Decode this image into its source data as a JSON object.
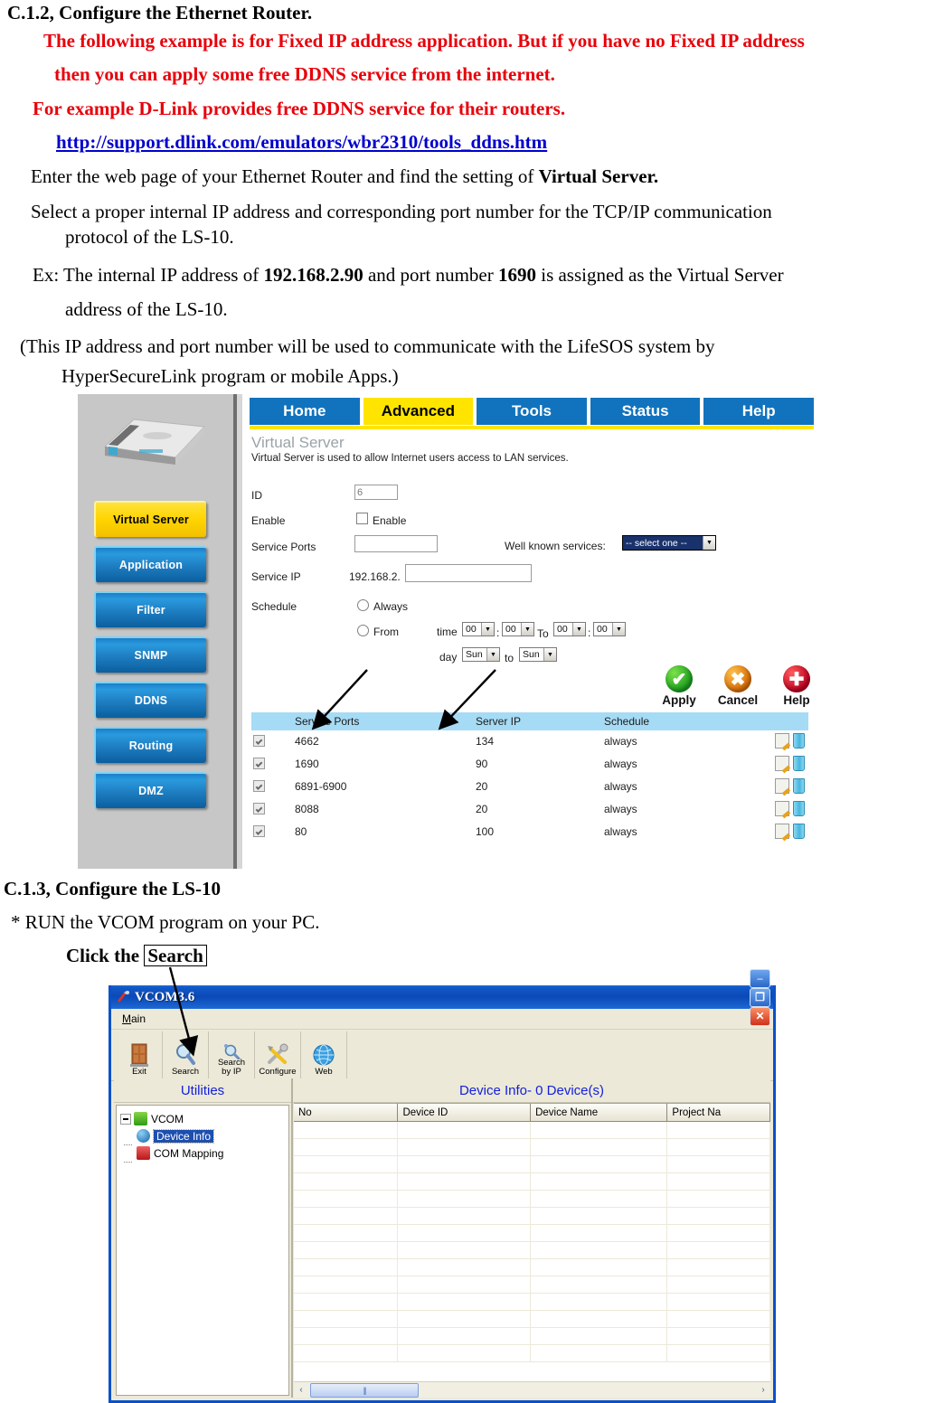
{
  "document": {
    "heading_c12": "C.1.2, Configure the Ethernet Router.",
    "red_line_1": "The following example is for Fixed IP address application. But if you have no Fixed IP address",
    "red_line_2": "then you can apply some free DDNS service from the internet.",
    "red_line_3": "For example D-Link provides free DDNS service for their routers.",
    "ddns_link": "http://support.dlink.com/emulators/wbr2310/tools_ddns.htm",
    "line_enter_prefix": "Enter the web page of your Ethernet Router and find the setting of ",
    "line_enter_bold": "Virtual Server.",
    "line_select": "Select a proper internal IP address and corresponding port number for the TCP/IP communication",
    "line_protocol": "protocol of the LS-10.",
    "line_ex_p1": "Ex: The internal IP address of ",
    "line_ex_b1": "192.168.2.90",
    "line_ex_p2": " and port number ",
    "line_ex_b2": "1690",
    "line_ex_p3": " is assigned as the Virtual Server",
    "line_address": "address of the LS-10.",
    "line_this": "(This IP address and port number will be used to communicate with the LifeSOS system by",
    "line_hyper": "HyperSecureLink program or mobile Apps.)",
    "heading_c13": "C.1.3, Configure the LS-10",
    "line_run": "* RUN the VCOM program on your PC.",
    "line_click_prefix": "Click the ",
    "line_click_boxed": "Search",
    "colors": {
      "red": "#e8000a",
      "link": "#0000cc",
      "text": "#000000"
    }
  },
  "router": {
    "tabs": [
      {
        "label": "Home",
        "active": false
      },
      {
        "label": "Advanced",
        "active": true
      },
      {
        "label": "Tools",
        "active": false
      },
      {
        "label": "Status",
        "active": false
      },
      {
        "label": "Help",
        "active": false
      }
    ],
    "page_title": "Virtual Server",
    "page_subtitle": "Virtual Server is used to allow Internet users access to LAN services.",
    "sidebar_buttons": [
      {
        "label": "Virtual Server",
        "active": true
      },
      {
        "label": "Application",
        "active": false
      },
      {
        "label": "Filter",
        "active": false
      },
      {
        "label": "SNMP",
        "active": false
      },
      {
        "label": "DDNS",
        "active": false
      },
      {
        "label": "Routing",
        "active": false
      },
      {
        "label": "DMZ",
        "active": false
      }
    ],
    "form": {
      "id_label": "ID",
      "id_value": "6",
      "enable_label": "Enable",
      "enable_checkbox_label": "Enable",
      "enable_checked": false,
      "service_ports_label": "Service Ports",
      "service_ports_value": "",
      "well_known_label": "Well known services:",
      "well_known_value": "-- select one --",
      "service_ip_label": "Service IP",
      "service_ip_prefix": "192.168.2.",
      "service_ip_value": "",
      "schedule_label": "Schedule",
      "always_label": "Always",
      "from_label": "From",
      "time_label": "time",
      "time_from_hour": "00",
      "time_from_min": "00",
      "to_label": "To",
      "time_to_hour": "00",
      "time_to_min": "00",
      "day_label": "day",
      "day_from": "Sun",
      "day_to_label": "to",
      "day_to": "Sun"
    },
    "actions": [
      {
        "label": "Apply",
        "icon": "check-circle-icon",
        "glyph": "✔",
        "color": "#1a9b1e"
      },
      {
        "label": "Cancel",
        "icon": "x-circle-icon",
        "glyph": "✖",
        "color": "#d56a06"
      },
      {
        "label": "Help",
        "icon": "plus-circle-icon",
        "glyph": "✚",
        "color": "#bb0020"
      }
    ],
    "table": {
      "headers": [
        "Service Ports",
        "Server IP",
        "Schedule"
      ],
      "rows": [
        {
          "checked": true,
          "ports": "4662",
          "server_ip": "134",
          "schedule": "always"
        },
        {
          "checked": true,
          "ports": "1690",
          "server_ip": "90",
          "schedule": "always"
        },
        {
          "checked": true,
          "ports": "6891-6900",
          "server_ip": "20",
          "schedule": "always"
        },
        {
          "checked": true,
          "ports": "8088",
          "server_ip": "20",
          "schedule": "always"
        },
        {
          "checked": true,
          "ports": "80",
          "server_ip": "100",
          "schedule": "always"
        }
      ]
    },
    "colors": {
      "tab_blue": "#1173bd",
      "tab_active": "#ffe400",
      "table_header": "#a6dbf5"
    }
  },
  "vcom": {
    "title": "VCOM3.6",
    "window_buttons": [
      {
        "name": "minimize",
        "glyph": "–"
      },
      {
        "name": "maximize",
        "glyph": "❐"
      },
      {
        "name": "close",
        "glyph": "✕"
      }
    ],
    "menu": [
      "Main"
    ],
    "toolbar": [
      {
        "label": "Exit",
        "label2": "",
        "icon": "door-icon"
      },
      {
        "label": "Search",
        "label2": "",
        "icon": "magnifier-icon"
      },
      {
        "label": "Search",
        "label2": "by IP",
        "icon": "magnifier-ip-icon"
      },
      {
        "label": "Configure",
        "label2": "",
        "icon": "tools-icon"
      },
      {
        "label": "Web",
        "label2": "",
        "icon": "globe-icon"
      }
    ],
    "left_panel_title": "Utilities",
    "tree": [
      {
        "label": "VCOM",
        "icon": "check-icon",
        "level": 0,
        "selected": false
      },
      {
        "label": "Device Info",
        "icon": "globe-icon",
        "level": 1,
        "selected": true
      },
      {
        "label": "COM Mapping",
        "icon": "phone-icon",
        "level": 1,
        "selected": false
      }
    ],
    "right_panel_title": "Device Info- 0 Device(s)",
    "grid_headers": [
      "No",
      "Device ID",
      "Device Name",
      "Project Na"
    ],
    "grid_rows": [],
    "scroll": {
      "left_glyph": "‹",
      "right_glyph": "›",
      "grip": "||||"
    },
    "colors": {
      "title_blue": "#0b49b8",
      "panel": "#ece9d8",
      "heading_text": "#1421d8"
    }
  }
}
